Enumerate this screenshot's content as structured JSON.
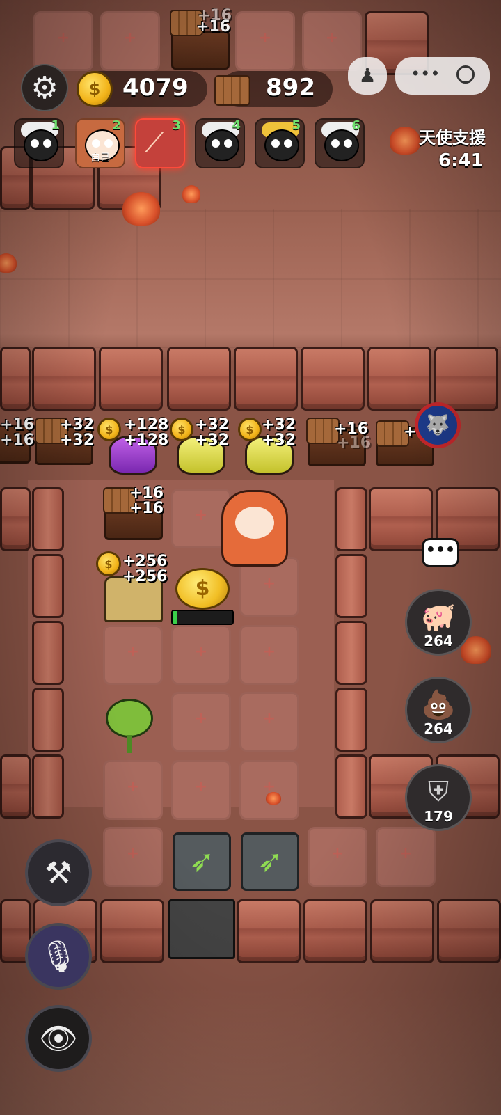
{
  "hud": {
    "gold": "4079",
    "wood": "892",
    "gold_icon": "coin-icon",
    "wood_icon": "logs-icon",
    "settings_icon": "gear-icon"
  },
  "players": [
    {
      "slot": "1",
      "tag": ""
    },
    {
      "slot": "2",
      "tag": "自己"
    },
    {
      "slot": "3",
      "tag": ""
    },
    {
      "slot": "4",
      "tag": ""
    },
    {
      "slot": "5",
      "tag": ""
    },
    {
      "slot": "6",
      "tag": ""
    }
  ],
  "support": {
    "label": "天使支援",
    "timer": "6:41"
  },
  "top_crate_bonus": [
    "+16",
    "+16"
  ],
  "row_bonuses": {
    "left_edge": [
      "+16",
      "+16"
    ],
    "logs_a": [
      "+32",
      "+32"
    ],
    "purple": [
      "+128",
      "+128"
    ],
    "yellow_a": [
      "+32",
      "+32"
    ],
    "yellow_b": [
      "+32",
      "+32"
    ],
    "logs_b": [
      "+16",
      "+16"
    ],
    "logs_c": [
      "+"
    ]
  },
  "inner_bonuses": {
    "logs": [
      "+16",
      "+16"
    ],
    "house": [
      "+256",
      "+256"
    ]
  },
  "bigcoin_symbol": "$",
  "production_progress": 0.08,
  "resources": [
    {
      "name": "piggy",
      "count": "264",
      "icon": "pig-icon"
    },
    {
      "name": "poop",
      "count": "264",
      "icon": "poop-icon"
    },
    {
      "name": "shield",
      "count": "179",
      "icon": "shield-icon"
    }
  ],
  "chat_icon": "chat-bubble-icon",
  "tools_icon": "tools-icon",
  "mic_icon": "microphone-icon",
  "eye_icon": "eye-icon",
  "colors": {
    "active_slot": "#c4413b",
    "bonus_text": "#ffffff",
    "progress": "#3bd04a"
  }
}
